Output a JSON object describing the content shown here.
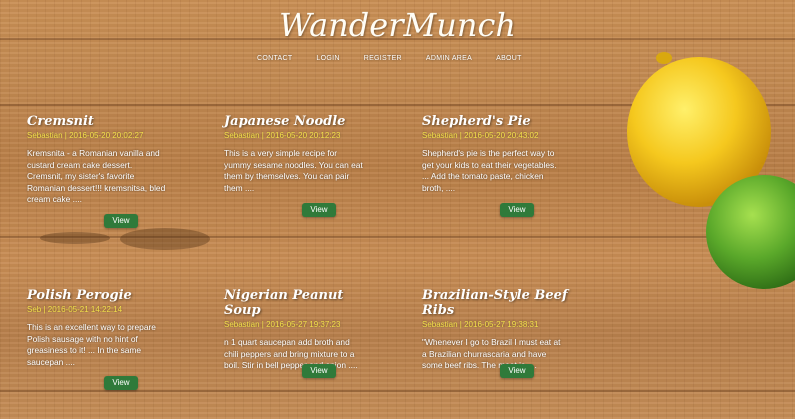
{
  "brand": "WanderMunch",
  "nav": [
    "CONTACT",
    "LOGIN",
    "REGISTER",
    "ADMIN AREA",
    "ABOUT"
  ],
  "view_label": "View",
  "recipes": [
    {
      "title": "Cremsnit",
      "meta": "Sebastian | 2016-05-20 20:02:27",
      "desc": "Kremsnita - a Romanian vanilla and\ncustard cream cake dessert.\nCremsnit, my sister's favorite\nRomanian dessert!!! kremsnitsa, bled\ncream cake ...."
    },
    {
      "title": "Japanese Noodle",
      "meta": "Sebastian | 2016-05-20 20:12:23",
      "desc": "This is a very simple recipe for\nyummy sesame noodles. You can eat\nthem by themselves. You can pair\nthem ...."
    },
    {
      "title": "Shepherd's Pie",
      "meta": "Sebastian | 2016-05-20 20:43:02",
      "desc": "Shepherd's pie is the perfect way to\nget your kids to eat their vegetables.\n... Add the tomato paste, chicken\nbroth, ...."
    },
    {
      "title": "Polish Perogie",
      "meta": "Seb | 2016-05-21 14:22:14",
      "desc": "This is an excellent way to prepare\nPolish sausage with no hint of\ngreasiness to it! ... In the same\nsaucepan ...."
    },
    {
      "title": "Nigerian Peanut Soup",
      "meta": "Sebastian | 2016-05-27 19:37:23",
      "desc": "n 1 quart saucepan add broth and\nchili peppers and bring mixture to a\nboil. Stir in bell pepper and onion ...."
    },
    {
      "title": "Brazilian-Style Beef Ribs",
      "meta": "Sebastian | 2016-05-27 19:38:31",
      "desc": "\"Whenever I go to Brazil I must eat at\na Brazilian churrascaria and have\nsome beef ribs. The meat is ...."
    }
  ],
  "colors": {
    "button": "#2f7a3a",
    "meta": "#f2e04a",
    "lemon": "#f5c81e",
    "lime": "#5aa82a"
  }
}
